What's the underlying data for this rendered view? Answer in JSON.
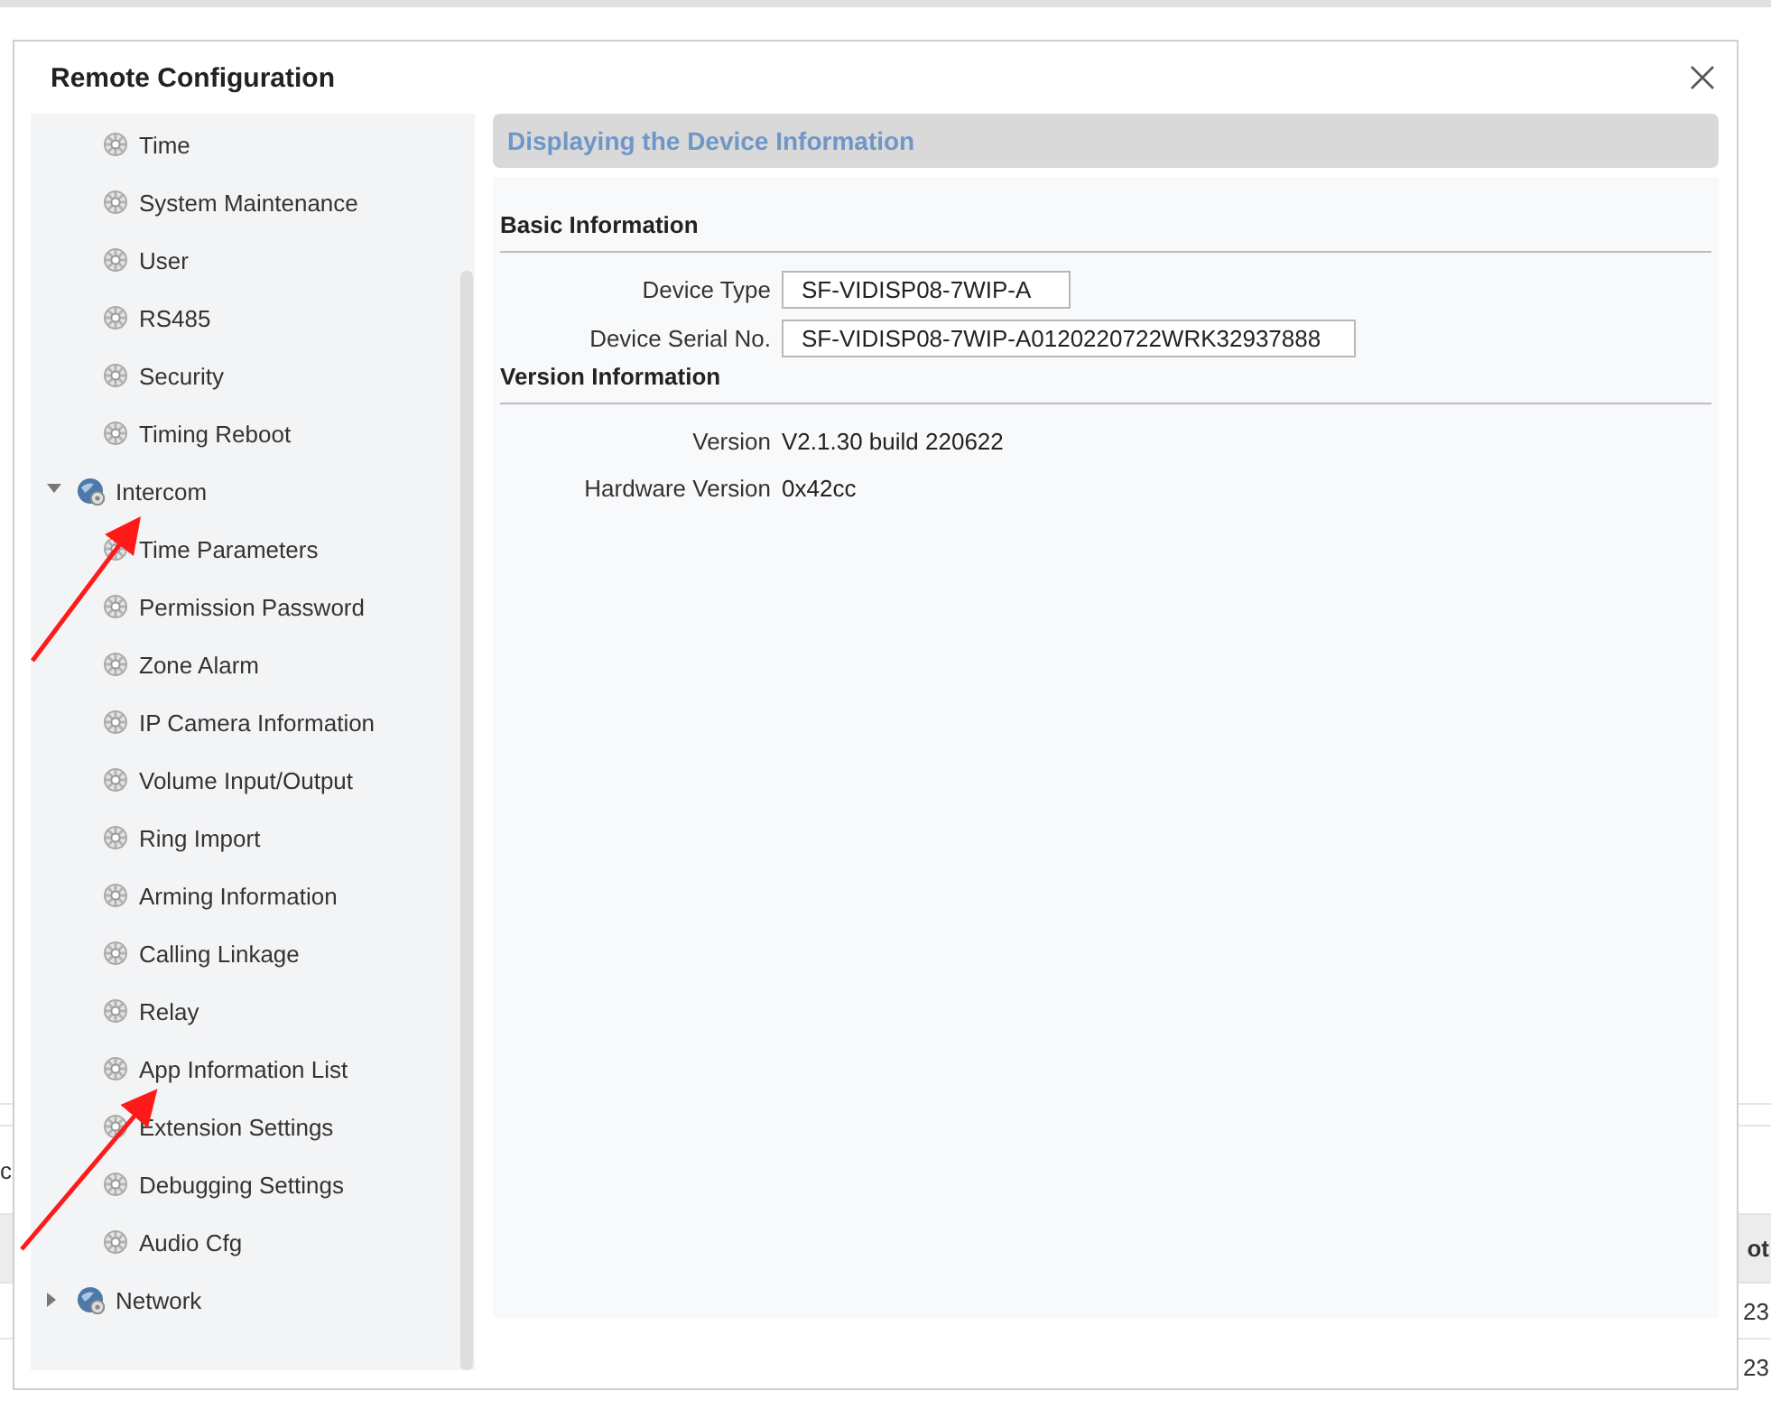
{
  "background_table": {
    "side_text": "c",
    "header": "ot",
    "cells": [
      "23",
      "23"
    ]
  },
  "dialog": {
    "title": "Remote Configuration",
    "sidebar": {
      "items": [
        {
          "kind": "setting",
          "label": "Time",
          "selected": false
        },
        {
          "kind": "setting",
          "label": "System Maintenance",
          "selected": false
        },
        {
          "kind": "setting",
          "label": "User",
          "selected": false
        },
        {
          "kind": "setting",
          "label": "RS485",
          "selected": false
        },
        {
          "kind": "setting",
          "label": "Security",
          "selected": false
        },
        {
          "kind": "setting",
          "label": "Timing Reboot",
          "selected": false
        },
        {
          "kind": "group",
          "label": "Intercom",
          "expanded": true,
          "children": [
            {
              "kind": "setting",
              "label": "Time Parameters",
              "selected": false
            },
            {
              "kind": "setting",
              "label": "Permission Password",
              "selected": false
            },
            {
              "kind": "setting",
              "label": "Zone Alarm",
              "selected": false
            },
            {
              "kind": "setting",
              "label": "IP Camera Information",
              "selected": false
            },
            {
              "kind": "setting",
              "label": "Volume Input/Output",
              "selected": false
            },
            {
              "kind": "setting",
              "label": "Ring Import",
              "selected": false
            },
            {
              "kind": "setting",
              "label": "Arming Information",
              "selected": false
            },
            {
              "kind": "setting",
              "label": "Calling Linkage",
              "selected": false
            },
            {
              "kind": "setting",
              "label": "Relay",
              "selected": false
            },
            {
              "kind": "setting",
              "label": "App Information List",
              "selected": false
            },
            {
              "kind": "setting",
              "label": "Extension Settings",
              "selected": false
            },
            {
              "kind": "setting",
              "label": "Debugging Settings",
              "selected": false
            },
            {
              "kind": "setting",
              "label": "Audio Cfg",
              "selected": false
            }
          ]
        },
        {
          "kind": "group",
          "label": "Network",
          "expanded": false
        }
      ]
    },
    "panel": {
      "title": "Displaying the Device Information",
      "sections": [
        {
          "title": "Basic Information",
          "fields": [
            {
              "kind": "input",
              "label": "Device Type",
              "value": "SF-VIDISP08-7WIP-A"
            },
            {
              "kind": "input",
              "label": "Device Serial No.",
              "value": "SF-VIDISP08-7WIP-A0120220722WRK32937888"
            }
          ]
        },
        {
          "title": "Version Information",
          "fields": [
            {
              "kind": "text",
              "label": "Version",
              "value": "V2.1.30 build 220622"
            },
            {
              "kind": "text",
              "label": "Hardware Version",
              "value": "0x42cc"
            }
          ]
        }
      ]
    }
  },
  "annotations": [
    {
      "kind": "arrow"
    },
    {
      "kind": "arrow"
    }
  ]
}
